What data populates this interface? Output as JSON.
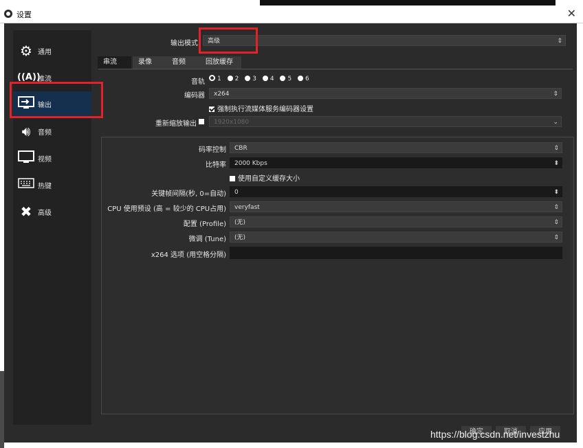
{
  "window": {
    "title": "设置"
  },
  "sidebar": {
    "items": [
      {
        "label": "通用",
        "icon": "gear-icon"
      },
      {
        "label": "推流",
        "icon": "broadcast-antenna-icon"
      },
      {
        "label": "输出",
        "icon": "output-monitor-icon"
      },
      {
        "label": "音频",
        "icon": "speaker-icon"
      },
      {
        "label": "视频",
        "icon": "monitor-icon"
      },
      {
        "label": "热键",
        "icon": "keyboard-icon"
      },
      {
        "label": "高级",
        "icon": "tools-icon"
      }
    ],
    "active": "输出"
  },
  "output": {
    "mode_label": "输出模式",
    "mode_value": "高级",
    "tabs": [
      "串流",
      "录像",
      "音频",
      "回放缓存"
    ],
    "active_tab": "串流",
    "track_label": "音轨",
    "tracks": [
      "1",
      "2",
      "3",
      "4",
      "5",
      "6"
    ],
    "selected_track": "1",
    "encoder_label": "编码器",
    "encoder_value": "x264",
    "enforce_label": "强制执行流媒体服务编码器设置",
    "enforce_checked": true,
    "rescale_label": "重新缩放输出",
    "rescale_checked": false,
    "rescale_value": "1920x1080"
  },
  "encoder_settings": {
    "rate_control_label": "码率控制",
    "rate_control_value": "CBR",
    "bitrate_label": "比特率",
    "bitrate_value": "2000 Kbps",
    "custom_buffer_label": "使用自定义缓存大小",
    "custom_buffer_checked": false,
    "keyframe_label": "关键帧间隔(秒, 0=自动)",
    "keyframe_value": "0",
    "cpu_preset_label": "CPU 使用预设 (高 = 较少的 CPU占用)",
    "cpu_preset_value": "veryfast",
    "profile_label": "配置 (Profile)",
    "profile_value": "(无)",
    "tune_label": "微调 (Tune)",
    "tune_value": "(无)",
    "x264_options_label": "x264 选项 (用空格分隔)",
    "x264_options_value": ""
  },
  "footer": {
    "ok": "确定",
    "cancel": "取消",
    "apply": "应用"
  },
  "watermark": "https://blog.csdn.net/investzhu",
  "colors": {
    "background": "#2b2b2b",
    "sidebar": "#222222",
    "active": "#15304f",
    "highlight": "#e2242a"
  }
}
